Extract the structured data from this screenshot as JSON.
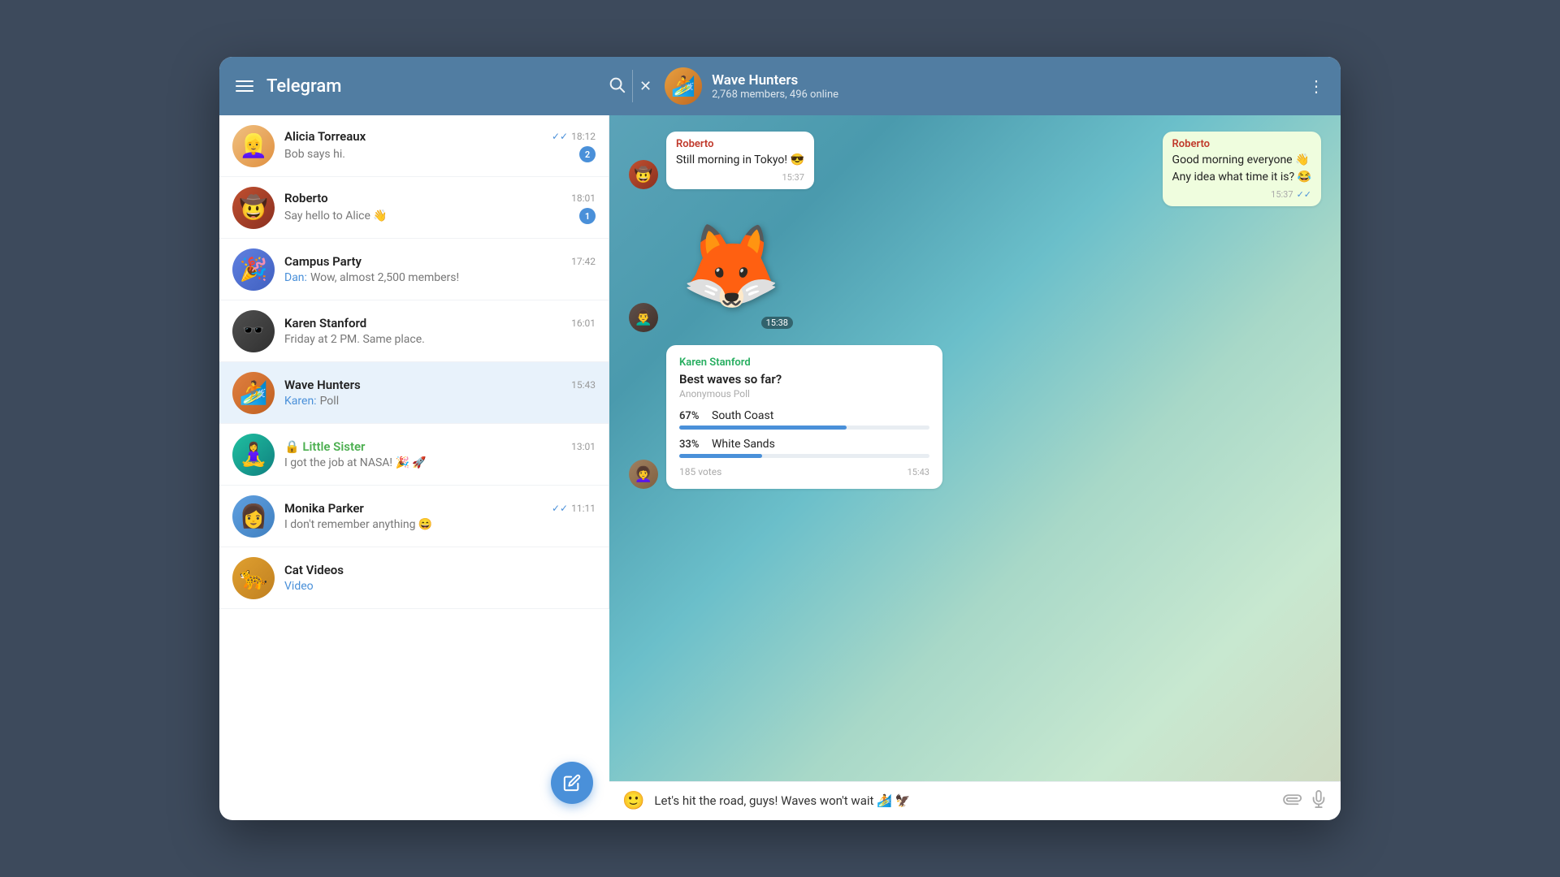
{
  "app": {
    "title": "Telegram",
    "window_bg": "#3d4a5c"
  },
  "header": {
    "app_title": "Telegram",
    "search_icon": "🔍",
    "close_icon": "✕",
    "more_icon": "⋮",
    "chat": {
      "name": "Wave Hunters",
      "members": "2,768 members, 496 online",
      "avatar_emoji": "🏄"
    }
  },
  "sidebar": {
    "chats": [
      {
        "id": "alicia",
        "name": "Alicia Torreaux",
        "preview": "Bob says hi.",
        "time": "18:12",
        "badge": "2",
        "has_check": true,
        "avatar_emoji": "👱‍♀️"
      },
      {
        "id": "roberto",
        "name": "Roberto",
        "preview": "Say hello to Alice 👋",
        "time": "18:01",
        "badge": "1",
        "has_check": false,
        "avatar_emoji": "🤠"
      },
      {
        "id": "campus",
        "name": "Campus Party",
        "preview": "Dan: Wow, almost 2,500 members!",
        "time": "17:42",
        "badge": null,
        "has_check": false,
        "avatar_emoji": "🎉",
        "sender_highlight": "Dan"
      },
      {
        "id": "karen",
        "name": "Karen Stanford",
        "preview": "Friday at 2 PM. Same place.",
        "time": "16:01",
        "badge": null,
        "has_check": false,
        "avatar_emoji": "🕶️"
      },
      {
        "id": "wave",
        "name": "Wave Hunters",
        "preview": "Karen: Poll",
        "time": "15:43",
        "badge": null,
        "has_check": false,
        "avatar_emoji": "🏄",
        "active": true,
        "sender_highlight": "Karen"
      },
      {
        "id": "sister",
        "name": "🔒 Little Sister",
        "preview": "I got the job at NASA! 🎉 🚀",
        "time": "13:01",
        "badge": null,
        "has_check": false,
        "avatar_emoji": "🧘‍♀️",
        "name_color": "#4caf50"
      },
      {
        "id": "monika",
        "name": "Monika Parker",
        "preview": "I don't remember anything 😄",
        "time": "11:11",
        "badge": null,
        "has_check": true,
        "avatar_emoji": "👩"
      },
      {
        "id": "cat",
        "name": "Cat Videos",
        "preview": "Video",
        "time": "",
        "badge": null,
        "has_check": false,
        "avatar_emoji": "🐱",
        "preview_highlight": "Video"
      }
    ],
    "fab_icon": "✏️"
  },
  "chat": {
    "messages": [
      {
        "id": "msg1",
        "sender": "Roberto",
        "sender_color": "roberto",
        "text": "Still morning in Tokyo! 😎",
        "time": "15:37",
        "outgoing": false,
        "avatar_emoji": "🤠"
      },
      {
        "id": "msg2",
        "type": "sticker",
        "time": "15:38",
        "avatar_emoji": "👨‍🦱"
      },
      {
        "id": "msg3",
        "sender": "Karen Stanford",
        "sender_color": "karen",
        "type": "poll",
        "poll_title": "Best waves so far?",
        "poll_type": "Anonymous Poll",
        "options": [
          {
            "label": "South Coast",
            "pct": 67
          },
          {
            "label": "White Sands",
            "pct": 33
          }
        ],
        "votes": "185 votes",
        "time": "15:43",
        "avatar_emoji": "👩‍🦱"
      }
    ],
    "outgoing_message": {
      "sender": "Roberto",
      "text": "Good morning everyone 👋\nAny idea what time it is? 😂",
      "time": "15:37",
      "has_check": true
    },
    "input": {
      "placeholder": "Let's hit the road, guys! Waves won't wait 🏄 🦅",
      "emoji_icon": "😊",
      "attach_icon": "📎",
      "mic_icon": "🎤"
    }
  },
  "colors": {
    "header_bg": "#517da2",
    "active_chat_bg": "#e8f2fb",
    "badge_bg": "#4a90d9",
    "outgoing_bubble": "#effdde",
    "poll_bar": "#4a90d9",
    "roberto_color": "#c0392b",
    "karen_color": "#27ae60"
  }
}
